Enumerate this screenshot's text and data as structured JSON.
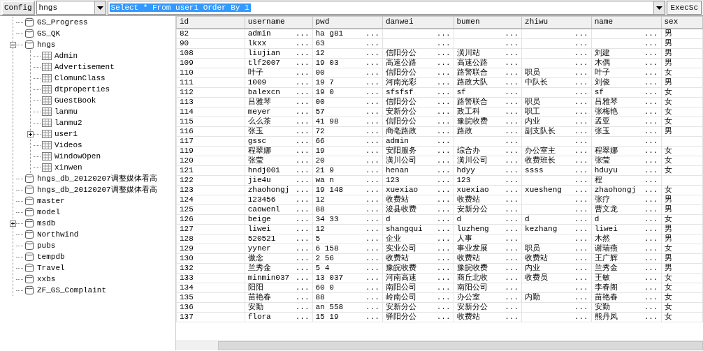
{
  "toolbar": {
    "config_button": "Config",
    "database_select": "hngs",
    "query": {
      "text": "Select * From user1 Order By 1",
      "selected": true
    },
    "exec_button": "ExecSc"
  },
  "tree": [
    {
      "label": "GS_Progress",
      "kind": "database"
    },
    {
      "label": "GS_QK",
      "kind": "database"
    },
    {
      "label": "hngs",
      "kind": "database",
      "expanded": true,
      "children": [
        {
          "label": "Admin",
          "kind": "table"
        },
        {
          "label": "Advertisement",
          "kind": "table"
        },
        {
          "label": "ClomunClass",
          "kind": "table"
        },
        {
          "label": "dtproperties",
          "kind": "table"
        },
        {
          "label": "GuestBook",
          "kind": "table"
        },
        {
          "label": "lanmu",
          "kind": "table"
        },
        {
          "label": "lanmu2",
          "kind": "table"
        },
        {
          "label": "user1",
          "kind": "table",
          "expanded": false
        },
        {
          "label": "Videos",
          "kind": "table"
        },
        {
          "label": "WindowOpen",
          "kind": "table"
        },
        {
          "label": "xinwen",
          "kind": "table"
        }
      ]
    },
    {
      "label": "hngs_db_20120207调整媒体看高",
      "kind": "database"
    },
    {
      "label": "hngs_db_20120207调整媒体看高",
      "kind": "database"
    },
    {
      "label": "master",
      "kind": "database"
    },
    {
      "label": "model",
      "kind": "database"
    },
    {
      "label": "msdb",
      "kind": "database",
      "expanded": false
    },
    {
      "label": "Northwind",
      "kind": "database"
    },
    {
      "label": "pubs",
      "kind": "database"
    },
    {
      "label": "tempdb",
      "kind": "database"
    },
    {
      "label": "Travel",
      "kind": "database"
    },
    {
      "label": "xxbs",
      "kind": "database"
    },
    {
      "label": "ZF_GS_Complaint",
      "kind": "database"
    }
  ],
  "table": {
    "columns": [
      "id",
      "username",
      "pwd",
      "danwei",
      "bumen",
      "zhiwu",
      "name",
      "sex"
    ],
    "rows": [
      [
        "82",
        [
          "admin",
          "..."
        ],
        [
          "ha g81",
          "..."
        ],
        [
          "..."
        ],
        [
          "..."
        ],
        [
          "..."
        ],
        [
          "..."
        ],
        "男"
      ],
      [
        "90",
        [
          "lkxx",
          "..."
        ],
        [
          "63",
          "..."
        ],
        [
          "..."
        ],
        [
          "..."
        ],
        [
          "..."
        ],
        [
          "..."
        ],
        "男"
      ],
      [
        "108",
        [
          "liujian",
          "..."
        ],
        [
          "12",
          "..."
        ],
        [
          "信阳分公",
          "..."
        ],
        [
          "潢川站",
          "..."
        ],
        [
          "..."
        ],
        [
          "刘建",
          "..."
        ],
        "男"
      ],
      [
        "109",
        [
          "tlf2007",
          "..."
        ],
        [
          "19 03",
          "..."
        ],
        [
          "高速公路",
          "..."
        ],
        [
          "高速公路",
          "..."
        ],
        [
          "..."
        ],
        [
          "木偶",
          "..."
        ],
        "男"
      ],
      [
        "110",
        [
          "叶子",
          "..."
        ],
        [
          "00",
          "..."
        ],
        [
          "信阳分公",
          "..."
        ],
        [
          "路警联合",
          "..."
        ],
        [
          "职员",
          "..."
        ],
        [
          "叶子",
          "..."
        ],
        "女"
      ],
      [
        "111",
        [
          "1009",
          "..."
        ],
        [
          "19 7",
          "..."
        ],
        [
          "河南光彩",
          "..."
        ],
        [
          "路政大队",
          "..."
        ],
        [
          "中队长",
          "..."
        ],
        [
          "刘俊",
          "..."
        ],
        "男"
      ],
      [
        "112",
        [
          "balexcn",
          "..."
        ],
        [
          "19 0",
          "..."
        ],
        [
          "sfsfsf",
          "..."
        ],
        [
          "sf",
          "..."
        ],
        [
          "..."
        ],
        [
          "sf",
          "..."
        ],
        "女"
      ],
      [
        "113",
        [
          "吕雅琴",
          "..."
        ],
        [
          "00",
          "..."
        ],
        [
          "信阳分公",
          "..."
        ],
        [
          "路警联合",
          "..."
        ],
        [
          "职员",
          "..."
        ],
        [
          "吕雅琴",
          "..."
        ],
        "女"
      ],
      [
        "114",
        [
          "meyer",
          "..."
        ],
        [
          "57",
          "..."
        ],
        [
          "安新分公",
          "..."
        ],
        [
          "政工科",
          "..."
        ],
        [
          "职工",
          "..."
        ],
        [
          "张梅艳",
          "..."
        ],
        "女"
      ],
      [
        "115",
        [
          "么么茶",
          "..."
        ],
        [
          "41 98",
          "..."
        ],
        [
          "信阳分公",
          "..."
        ],
        [
          "豫皖收费",
          "..."
        ],
        [
          "内业",
          "..."
        ],
        [
          "孟亚",
          "..."
        ],
        "女"
      ],
      [
        "116",
        [
          "张玉",
          "..."
        ],
        [
          "72",
          "..."
        ],
        [
          "商亳路政",
          "..."
        ],
        [
          "路政",
          "..."
        ],
        [
          "副支队长",
          "..."
        ],
        [
          "张玉",
          "..."
        ],
        "男"
      ],
      [
        "117",
        [
          "gssc",
          "..."
        ],
        [
          "66",
          "..."
        ],
        [
          "admin",
          "..."
        ],
        [
          "..."
        ],
        [
          "..."
        ],
        [
          "..."
        ],
        null
      ],
      [
        "119",
        [
          "程翠娜",
          "..."
        ],
        [
          "19",
          "..."
        ],
        [
          "安阳服务",
          "..."
        ],
        [
          "综合办",
          "..."
        ],
        [
          "办公室主",
          "..."
        ],
        [
          "程翠娜",
          "..."
        ],
        "女"
      ],
      [
        "120",
        [
          "张莹",
          "..."
        ],
        [
          "20",
          "..."
        ],
        [
          "潢川公司",
          "..."
        ],
        [
          "潢川公司",
          "..."
        ],
        [
          "收费班长",
          "..."
        ],
        [
          "张莹",
          "..."
        ],
        "女"
      ],
      [
        "121",
        [
          "hndj001",
          "..."
        ],
        [
          "21 9",
          "..."
        ],
        [
          "henan",
          "..."
        ],
        [
          "hdyy",
          "..."
        ],
        [
          "ssss",
          "..."
        ],
        [
          "hduyu",
          "..."
        ],
        "女"
      ],
      [
        "122",
        [
          "jie4u",
          "..."
        ],
        [
          "wa n",
          "..."
        ],
        [
          "123",
          "..."
        ],
        [
          "123",
          "..."
        ],
        [
          "..."
        ],
        [
          "程",
          "..."
        ],
        null
      ],
      [
        "123",
        [
          "zhaohongj",
          "..."
        ],
        [
          "19 148",
          "..."
        ],
        [
          "xuexiao",
          "..."
        ],
        [
          "xuexiao",
          "..."
        ],
        [
          "xuesheng",
          "..."
        ],
        [
          "zhaohongj",
          "..."
        ],
        "女"
      ],
      [
        "124",
        [
          "123456",
          "..."
        ],
        [
          "12",
          "..."
        ],
        [
          "收费站",
          "..."
        ],
        [
          "收费站",
          "..."
        ],
        [
          "..."
        ],
        [
          "张疗",
          "..."
        ],
        "男"
      ],
      [
        "125",
        [
          "caowenl",
          "..."
        ],
        [
          "88",
          "..."
        ],
        [
          "浚县收费",
          "..."
        ],
        [
          "安新分公",
          "..."
        ],
        [
          "..."
        ],
        [
          "曹文龙",
          "..."
        ],
        "男"
      ],
      [
        "126",
        [
          "beige",
          "..."
        ],
        [
          "34 33",
          "..."
        ],
        [
          "d",
          "..."
        ],
        [
          "d",
          "..."
        ],
        [
          "d",
          "..."
        ],
        [
          "d",
          "..."
        ],
        "女"
      ],
      [
        "127",
        [
          "liwei",
          "..."
        ],
        [
          "12",
          "..."
        ],
        [
          "shangqui",
          "..."
        ],
        [
          "luzheng",
          "..."
        ],
        [
          "kezhang",
          "..."
        ],
        [
          "liwei",
          "..."
        ],
        "男"
      ],
      [
        "128",
        [
          "520521",
          "..."
        ],
        [
          "5",
          "..."
        ],
        [
          "企业",
          "..."
        ],
        [
          "人事",
          "..."
        ],
        [
          "..."
        ],
        [
          "木然",
          "..."
        ],
        "男"
      ],
      [
        "129",
        [
          "yyner",
          "..."
        ],
        [
          "6 158",
          "..."
        ],
        [
          "实业公司",
          "..."
        ],
        [
          "事业发展",
          "..."
        ],
        [
          "职员",
          "..."
        ],
        [
          "谢瑞燕",
          "..."
        ],
        "女"
      ],
      [
        "130",
        [
          "傲念",
          "..."
        ],
        [
          "2 56",
          "..."
        ],
        [
          "收费站",
          "..."
        ],
        [
          "收费站",
          "..."
        ],
        [
          "收费站",
          "..."
        ],
        [
          "王广辉",
          "..."
        ],
        "男"
      ],
      [
        "132",
        [
          "兰秀金",
          "..."
        ],
        [
          "5 4",
          "..."
        ],
        [
          "豫皖收费",
          "..."
        ],
        [
          "豫皖收费",
          "..."
        ],
        [
          "内业",
          "..."
        ],
        [
          "兰秀金",
          "..."
        ],
        "男"
      ],
      [
        "133",
        [
          "minmin037",
          "..."
        ],
        [
          "13 037",
          "..."
        ],
        [
          "河南高速",
          "..."
        ],
        [
          "商丘北收",
          "..."
        ],
        [
          "收费员",
          "..."
        ],
        [
          "王敏",
          "..."
        ],
        "女"
      ],
      [
        "134",
        [
          "阳阳",
          "..."
        ],
        [
          "60 0",
          "..."
        ],
        [
          "南阳公司",
          "..."
        ],
        [
          "南阳公司",
          "..."
        ],
        [
          "..."
        ],
        [
          "李春阁",
          "..."
        ],
        "女"
      ],
      [
        "135",
        [
          "苗艳春",
          "..."
        ],
        [
          "88",
          "..."
        ],
        [
          "岭南公司",
          "..."
        ],
        [
          "办公室",
          "..."
        ],
        [
          "内勤",
          "..."
        ],
        [
          "苗艳春",
          "..."
        ],
        "女"
      ],
      [
        "136",
        [
          "安勤",
          "..."
        ],
        [
          "an 558",
          "..."
        ],
        [
          "安新分公",
          "..."
        ],
        [
          "安新分公",
          "..."
        ],
        [
          "..."
        ],
        [
          "安勤",
          "..."
        ],
        "女"
      ],
      [
        "137",
        [
          "flora",
          "..."
        ],
        [
          "15 19",
          "..."
        ],
        [
          "驿阳分公",
          "..."
        ],
        [
          "收费站",
          "..."
        ],
        [
          "..."
        ],
        [
          "熊丹凤",
          "..."
        ],
        "女"
      ]
    ]
  }
}
